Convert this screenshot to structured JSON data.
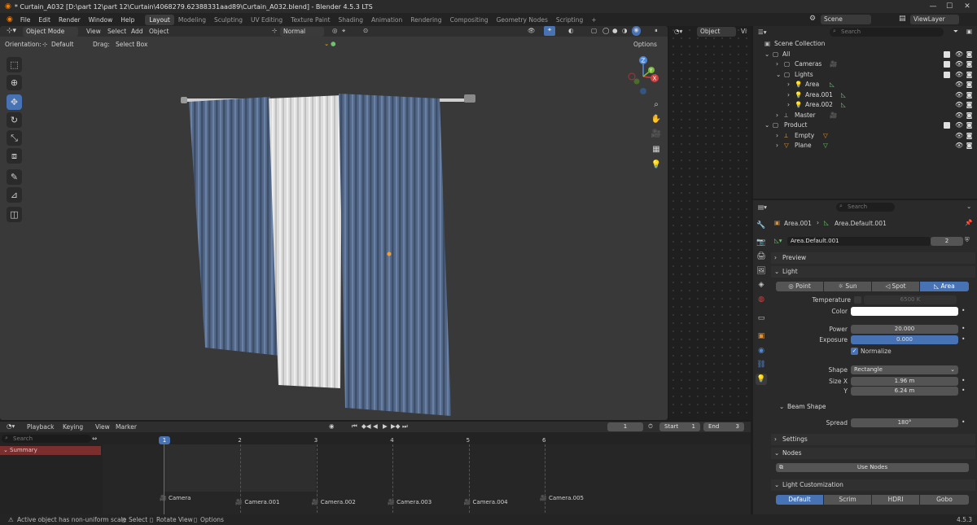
{
  "window": {
    "title": "* Curtain_A032 [D:\\part 12\\part 12\\Curtain\\4068279.62388331aad89\\Curtain_A032.blend] - Blender 4.5.3 LTS"
  },
  "menu": {
    "items": [
      "File",
      "Edit",
      "Render",
      "Window",
      "Help"
    ]
  },
  "workspaces": [
    "Layout",
    "Modeling",
    "Sculpting",
    "UV Editing",
    "Texture Paint",
    "Shading",
    "Animation",
    "Rendering",
    "Compositing",
    "Geometry Nodes",
    "Scripting"
  ],
  "scene": {
    "name": "Scene",
    "view_layer": "ViewLayer"
  },
  "viewport": {
    "mode": "Object Mode",
    "menu": [
      "View",
      "Select",
      "Add",
      "Object"
    ],
    "orientation_label": "Orientation:",
    "orientation_value": "Default",
    "drag_label": "Drag:",
    "drag_value": "Select Box",
    "transform_orientation": "Normal",
    "options": "Options",
    "gizmo_axes": {
      "x": "X",
      "y": "Y",
      "z": "Z"
    }
  },
  "node_editor": {
    "mode": "Object",
    "label": "Vi"
  },
  "outliner": {
    "search_placeholder": "Search",
    "rows": [
      {
        "label": "Scene Collection",
        "indent": 0
      },
      {
        "label": "All",
        "indent": 1
      },
      {
        "label": "Cameras",
        "indent": 2
      },
      {
        "label": "Lights",
        "indent": 2
      },
      {
        "label": "Area",
        "indent": 3
      },
      {
        "label": "Area.001",
        "indent": 3
      },
      {
        "label": "Area.002",
        "indent": 3
      },
      {
        "label": "Master",
        "indent": 2
      },
      {
        "label": "Product",
        "indent": 1
      },
      {
        "label": "Empty",
        "indent": 2
      },
      {
        "label": "Plane",
        "indent": 2
      }
    ]
  },
  "properties": {
    "search_placeholder": "Search",
    "breadcrumb_object": "Area.001",
    "breadcrumb_data": "Area.Default.001",
    "datablock": "Area.Default.001",
    "users": "2",
    "sections": {
      "preview": "Preview",
      "light": "Light",
      "beam_shape": "Beam Shape",
      "settings": "Settings",
      "nodes": "Nodes",
      "light_customization": "Light Customization"
    },
    "light_types": [
      "Point",
      "Sun",
      "Spot",
      "Area"
    ],
    "active_light_type": "Area",
    "temperature_label": "Temperature",
    "temperature_value": "6500 K",
    "color_label": "Color",
    "color_value": "#ffffff",
    "power_label": "Power",
    "power_value": "20.000",
    "exposure_label": "Exposure",
    "exposure_value": "0.000",
    "normalize_label": "Normalize",
    "shape_label": "Shape",
    "shape_value": "Rectangle",
    "size_x_label": "Size X",
    "size_x_value": "1.96 m",
    "y_label": "Y",
    "y_value": "6.24 m",
    "spread_label": "Spread",
    "spread_value": "180°",
    "use_nodes": "Use Nodes",
    "customization_tabs": [
      "Default",
      "Scrim",
      "HDRI",
      "Gobo"
    ],
    "active_customization": "Default"
  },
  "timeline": {
    "menu": [
      "Playback",
      "Keying",
      "View",
      "Marker"
    ],
    "current_frame": "1",
    "start_label": "Start",
    "start_value": "1",
    "end_label": "End",
    "end_value": "3",
    "search_placeholder": "Search",
    "summary": "Summary",
    "frames": [
      "1",
      "2",
      "3",
      "4",
      "5",
      "6"
    ],
    "markers": [
      "Camera",
      "Camera.001",
      "Camera.002",
      "Camera.003",
      "Camera.004",
      "Camera.005"
    ]
  },
  "status": {
    "message": "Active object has non-uniform scale",
    "select": "Select",
    "rotate": "Rotate View",
    "options": "Options",
    "version": "4.5.3"
  },
  "colors": {
    "accent": "#4772b3",
    "curtain_blue": "#54698a",
    "curtain_white": "#dcdcdc",
    "summary_red": "#7a2e2e"
  }
}
